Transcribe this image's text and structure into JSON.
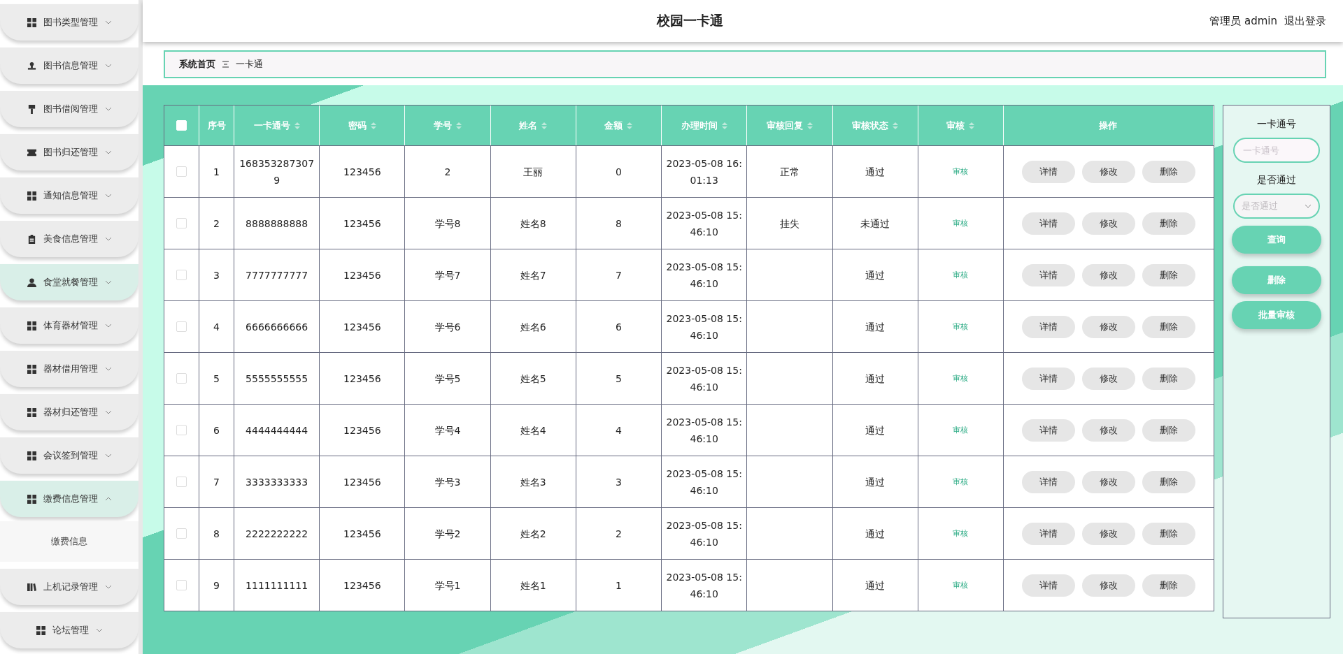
{
  "sidebar": {
    "items": [
      {
        "label": "图书类型管理",
        "highlighted": false,
        "expanded": false
      },
      {
        "label": "图书信息管理",
        "highlighted": false,
        "expanded": false
      },
      {
        "label": "图书借阅管理",
        "highlighted": false,
        "expanded": false
      },
      {
        "label": "图书归还管理",
        "highlighted": false,
        "expanded": false
      },
      {
        "label": "通知信息管理",
        "highlighted": false,
        "expanded": false
      },
      {
        "label": "美食信息管理",
        "highlighted": false,
        "expanded": false
      },
      {
        "label": "食堂就餐管理",
        "highlighted": true,
        "expanded": false
      },
      {
        "label": "体育器材管理",
        "highlighted": false,
        "expanded": false
      },
      {
        "label": "器材借用管理",
        "highlighted": false,
        "expanded": false
      },
      {
        "label": "器材归还管理",
        "highlighted": false,
        "expanded": false
      },
      {
        "label": "会议签到管理",
        "highlighted": false,
        "expanded": false
      },
      {
        "label": "缴费信息管理",
        "highlighted": true,
        "expanded": true,
        "children": [
          {
            "label": "缴费信息"
          }
        ]
      },
      {
        "label": "上机记录管理",
        "highlighted": false,
        "expanded": false
      },
      {
        "label": "论坛管理",
        "highlighted": false,
        "expanded": false
      }
    ]
  },
  "header": {
    "title": "校园一卡通",
    "user": "管理员 admin",
    "logout": "退出登录"
  },
  "breadcrumb": {
    "home": "系统首页",
    "current": "一卡通"
  },
  "table": {
    "select_all": {
      "checked": false
    },
    "columns": [
      {
        "label": "序号",
        "sortable": false
      },
      {
        "label": "一卡通号",
        "sortable": true
      },
      {
        "label": "密码",
        "sortable": true
      },
      {
        "label": "学号",
        "sortable": true
      },
      {
        "label": "姓名",
        "sortable": true
      },
      {
        "label": "金额",
        "sortable": true
      },
      {
        "label": "办理时间",
        "sortable": true
      },
      {
        "label": "审核回复",
        "sortable": true
      },
      {
        "label": "审核状态",
        "sortable": true
      },
      {
        "label": "审核",
        "sortable": true
      },
      {
        "label": "操作",
        "sortable": false
      }
    ],
    "rows": [
      {
        "checked": false,
        "cells": [
          "1",
          "1683532873079",
          "123456",
          "2",
          "王丽",
          "0",
          "2023-05-08 16:01:13",
          "正常",
          "通过"
        ],
        "review": "审核",
        "actions": [
          "详情",
          "修改",
          "删除"
        ]
      },
      {
        "checked": false,
        "cells": [
          "2",
          "8888888888",
          "123456",
          "学号8",
          "姓名8",
          "8",
          "2023-05-08 15:46:10",
          "挂失",
          "未通过"
        ],
        "review": "审核",
        "actions": [
          "详情",
          "修改",
          "删除"
        ]
      },
      {
        "checked": false,
        "cells": [
          "3",
          "7777777777",
          "123456",
          "学号7",
          "姓名7",
          "7",
          "2023-05-08 15:46:10",
          "",
          "通过"
        ],
        "review": "审核",
        "actions": [
          "详情",
          "修改",
          "删除"
        ]
      },
      {
        "checked": false,
        "cells": [
          "4",
          "6666666666",
          "123456",
          "学号6",
          "姓名6",
          "6",
          "2023-05-08 15:46:10",
          "",
          "通过"
        ],
        "review": "审核",
        "actions": [
          "详情",
          "修改",
          "删除"
        ]
      },
      {
        "checked": false,
        "cells": [
          "5",
          "5555555555",
          "123456",
          "学号5",
          "姓名5",
          "5",
          "2023-05-08 15:46:10",
          "",
          "通过"
        ],
        "review": "审核",
        "actions": [
          "详情",
          "修改",
          "删除"
        ]
      },
      {
        "checked": false,
        "cells": [
          "6",
          "4444444444",
          "123456",
          "学号4",
          "姓名4",
          "4",
          "2023-05-08 15:46:10",
          "",
          "通过"
        ],
        "review": "审核",
        "actions": [
          "详情",
          "修改",
          "删除"
        ]
      },
      {
        "checked": false,
        "cells": [
          "7",
          "3333333333",
          "123456",
          "学号3",
          "姓名3",
          "3",
          "2023-05-08 15:46:10",
          "",
          "通过"
        ],
        "review": "审核",
        "actions": [
          "详情",
          "修改",
          "删除"
        ]
      },
      {
        "checked": false,
        "cells": [
          "8",
          "2222222222",
          "123456",
          "学号2",
          "姓名2",
          "2",
          "2023-05-08 15:46:10",
          "",
          "通过"
        ],
        "review": "审核",
        "actions": [
          "详情",
          "修改",
          "删除"
        ]
      },
      {
        "checked": false,
        "cells": [
          "9",
          "1111111111",
          "123456",
          "学号1",
          "姓名1",
          "1",
          "2023-05-08 15:46:10",
          "",
          "通过"
        ],
        "review": "审核",
        "actions": [
          "详情",
          "修改",
          "删除"
        ]
      }
    ]
  },
  "search_panel": {
    "card_label": "一卡通号",
    "card_placeholder": "一卡通号",
    "pass_label": "是否通过",
    "pass_placeholder": "是否通过",
    "buttons": [
      "查询",
      "删除",
      "批量审核"
    ]
  }
}
